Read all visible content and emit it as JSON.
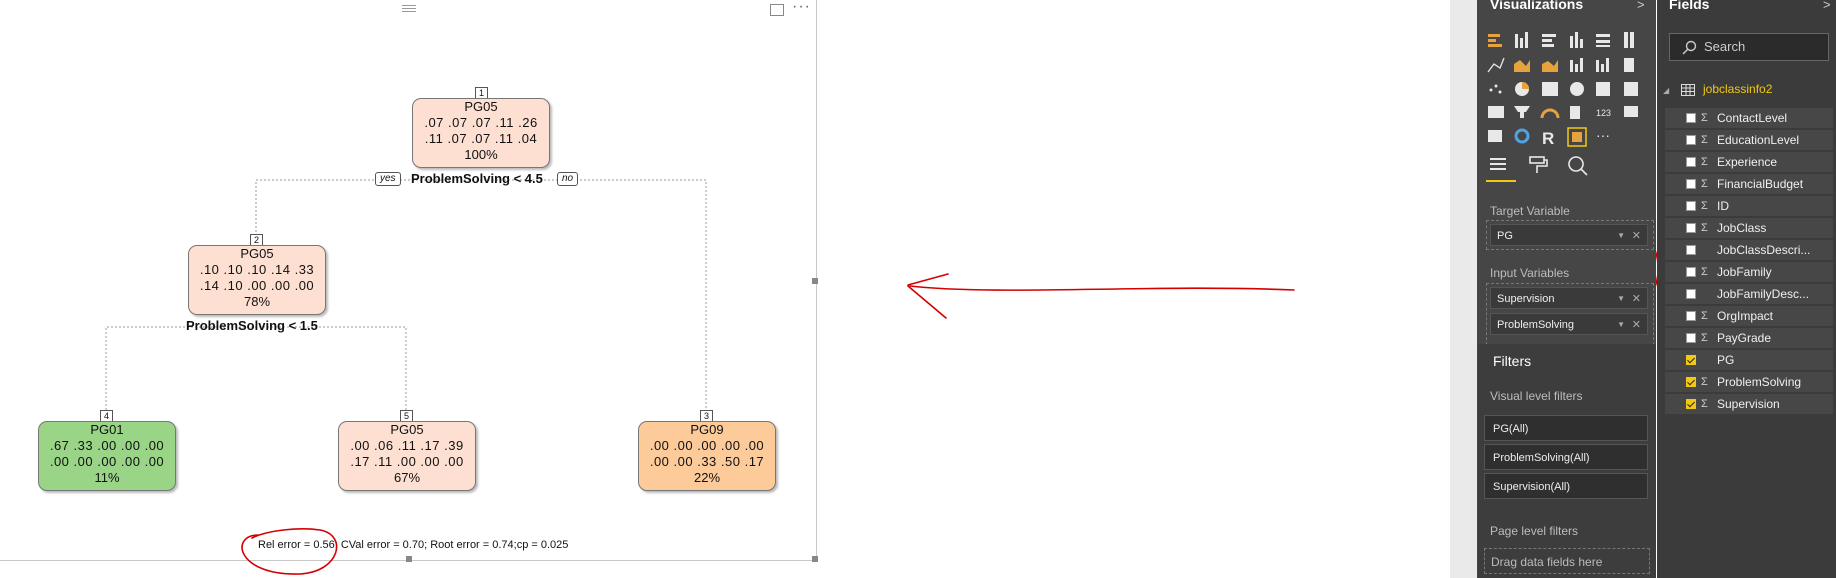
{
  "tree": {
    "nodes": [
      {
        "id": "1",
        "num": "1",
        "title": "PG05",
        "row1": ".07 .07 .07 .11 .26",
        "row2": ".11 .07 .07 .11 .04",
        "pct": "100%",
        "color": "#fde0d2"
      },
      {
        "id": "2",
        "num": "2",
        "title": "PG05",
        "row1": ".10 .10 .10 .14 .33",
        "row2": ".14 .10 .00 .00 .00",
        "pct": "78%",
        "color": "#fde0d2"
      },
      {
        "id": "4",
        "num": "4",
        "title": "PG01",
        "row1": ".67 .33 .00 .00 .00",
        "row2": ".00 .00 .00 .00 .00",
        "pct": "11%",
        "color": "#9ad487"
      },
      {
        "id": "5",
        "num": "5",
        "title": "PG05",
        "row1": ".00 .06 .11 .17 .39",
        "row2": ".17 .11 .00 .00 .00",
        "pct": "67%",
        "color": "#fde0d2"
      },
      {
        "id": "3",
        "num": "3",
        "title": "PG09",
        "row1": ".00 .00 .00 .00 .00",
        "row2": ".00 .00 .33 .50 .17",
        "pct": "22%",
        "color": "#fdcb9a"
      }
    ],
    "split1": "ProblemSolving < 4.5",
    "split2": "ProblemSolving < 1.5",
    "yes": "yes",
    "no": "no",
    "status": "Rel error  =  0.56; CVal error  =  0.70; Root error  =  0.74;cp  =  0.025"
  },
  "visualizations": {
    "title": "Visualizations",
    "target_label": "Target Variable",
    "target_field": "PG",
    "input_label": "Input Variables",
    "input_fields": [
      "Supervision",
      "ProblemSolving"
    ],
    "filters_title": "Filters",
    "visual_filters_label": "Visual level filters",
    "filters": [
      "PG(All)",
      "ProblemSolving(All)",
      "Supervision(All)"
    ],
    "page_filters_label": "Page level filters",
    "drag_hint": "Drag data fields here"
  },
  "fields": {
    "title": "Fields",
    "search_placeholder": "Search",
    "table_name": "jobclassinfo2",
    "items": [
      {
        "name": "ContactLevel",
        "sigma": "Σ",
        "checked": false
      },
      {
        "name": "EducationLevel",
        "sigma": "Σ",
        "checked": false
      },
      {
        "name": "Experience",
        "sigma": "Σ",
        "checked": false
      },
      {
        "name": "FinancialBudget",
        "sigma": "Σ",
        "checked": false
      },
      {
        "name": "ID",
        "sigma": "Σ",
        "checked": false
      },
      {
        "name": "JobClass",
        "sigma": "Σ",
        "checked": false
      },
      {
        "name": "JobClassDescri...",
        "sigma": "",
        "checked": false
      },
      {
        "name": "JobFamily",
        "sigma": "Σ",
        "checked": false
      },
      {
        "name": "JobFamilyDesc...",
        "sigma": "",
        "checked": false
      },
      {
        "name": "OrgImpact",
        "sigma": "Σ",
        "checked": false
      },
      {
        "name": "PayGrade",
        "sigma": "Σ",
        "checked": false
      },
      {
        "name": "PG",
        "sigma": "",
        "checked": true
      },
      {
        "name": "ProblemSolving",
        "sigma": "Σ",
        "checked": true
      },
      {
        "name": "Supervision",
        "sigma": "Σ",
        "checked": true
      }
    ]
  },
  "colors": {
    "accent": "#f2c811",
    "annotation": "#d40000"
  }
}
